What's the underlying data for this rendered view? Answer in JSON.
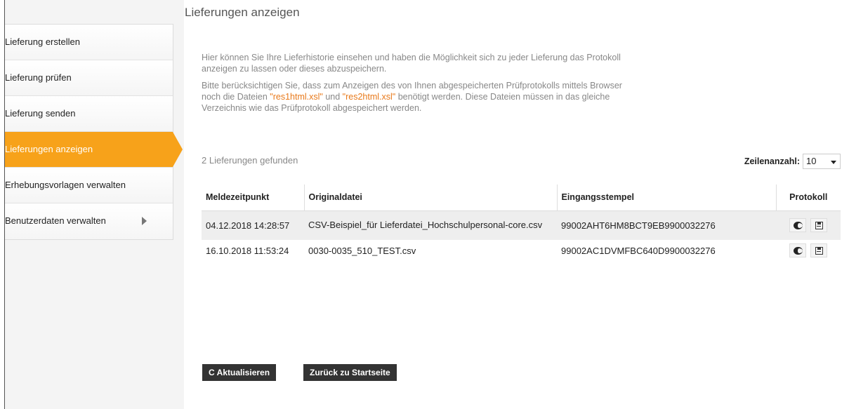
{
  "page": {
    "title": "Lieferungen anzeigen"
  },
  "sidebar": {
    "items": [
      {
        "label": "Lieferung erstellen"
      },
      {
        "label": "Lieferung prüfen"
      },
      {
        "label": "Lieferung senden"
      },
      {
        "label": "Lieferungen anzeigen",
        "active": true
      },
      {
        "label": "Erhebungsvorlagen verwalten"
      },
      {
        "label": "Benutzerdaten verwalten",
        "has_submenu": true
      }
    ]
  },
  "intro": {
    "p1": "Hier können Sie Ihre Lieferhistorie einsehen und haben die Möglichkeit sich zu jeder Lieferung das Protokoll anzeigen zu lassen oder dieses abzuspeichern.",
    "p2_a": "Bitte berücksichtigen Sie, dass zum Anzeigen des von Ihnen abgespeicherten Prüfprotokolls mittels Browser noch die Dateien ",
    "p2_link1": "\"res1html.xsl\"",
    "p2_b": " und ",
    "p2_link2": "\"res2html.xsl\"",
    "p2_c": " benötigt werden. Diese Dateien müssen in das gleiche Verzeichnis wie das Prüfprotokoll abgespeichert werden."
  },
  "results": {
    "found_text": "2 Lieferungen gefunden",
    "rows_label": "Zeilenanzahl:",
    "rows_value": "10"
  },
  "table": {
    "headers": [
      "Meldezeitpunkt",
      "Originaldatei",
      "Eingangsstempel",
      "Protokoll"
    ],
    "rows": [
      {
        "time": "04.12.2018 14:28:57",
        "file": "CSV-Beispiel_für Lieferdatei_Hochschulpersonal-core.csv",
        "stamp": "99002AHT6HM8BCT9EB9900032276"
      },
      {
        "time": "16.10.2018 11:53:24",
        "file": "0030-0035_510_TEST.csv",
        "stamp": "99002AC1DVMFBC640D9900032276"
      }
    ]
  },
  "buttons": {
    "refresh_icon": "C",
    "refresh": "Aktualisieren",
    "back": "Zurück zu Startseite"
  },
  "icons": {
    "view": "eye-icon",
    "save": "floppy-disk-icon",
    "refresh": "refresh-icon"
  },
  "colors": {
    "accent": "#f7a21a",
    "link": "#e8791a",
    "button": "#333333"
  }
}
